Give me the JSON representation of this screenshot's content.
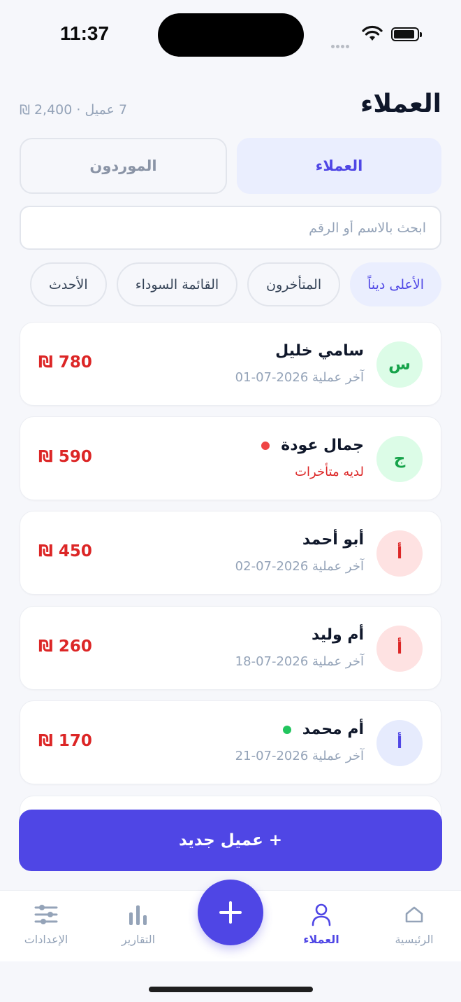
{
  "status_bar": {
    "time": "11:37"
  },
  "header": {
    "title": "العملاء",
    "summary": "7 عميل · 2,400 ₪"
  },
  "segments": {
    "customers": "العملاء",
    "suppliers": "الموردون"
  },
  "search": {
    "placeholder": "ابحث بالاسم أو الرقم"
  },
  "filters": [
    "الأعلى ديناً",
    "المتأخرون",
    "القائمة السوداء",
    "الأحدث"
  ],
  "customers": [
    {
      "initial": "س",
      "name": "سامي خليل",
      "subtitle": "آخر عملية 2026-07-01",
      "amount": "780 ₪",
      "avatar_color": "green",
      "status_dot": ""
    },
    {
      "initial": "ج",
      "name": "جمال عودة",
      "subtitle": "لديه متأخرات",
      "amount": "590 ₪",
      "avatar_color": "green",
      "status_dot": "red"
    },
    {
      "initial": "أ",
      "name": "أبو أحمد",
      "subtitle": "آخر عملية 2026-07-02",
      "amount": "450 ₪",
      "avatar_color": "red",
      "status_dot": ""
    },
    {
      "initial": "أ",
      "name": "أم وليد",
      "subtitle": "آخر عملية 2026-07-18",
      "amount": "260 ₪",
      "avatar_color": "red",
      "status_dot": ""
    },
    {
      "initial": "أ",
      "name": "أم محمد",
      "subtitle": "آخر عملية 2026-07-21",
      "amount": "170 ₪",
      "avatar_color": "blue",
      "status_dot": "green"
    }
  ],
  "add_customer_label": "+ عميل جديد",
  "tabbar": {
    "home": "الرئيسية",
    "customers": "العملاء",
    "reports": "التقارير",
    "settings": "الإعدادات"
  },
  "colors": {
    "accent": "#4f46e5",
    "debt": "#dc2626",
    "late_dot": "#ef4444",
    "active_dot": "#22c55e"
  }
}
